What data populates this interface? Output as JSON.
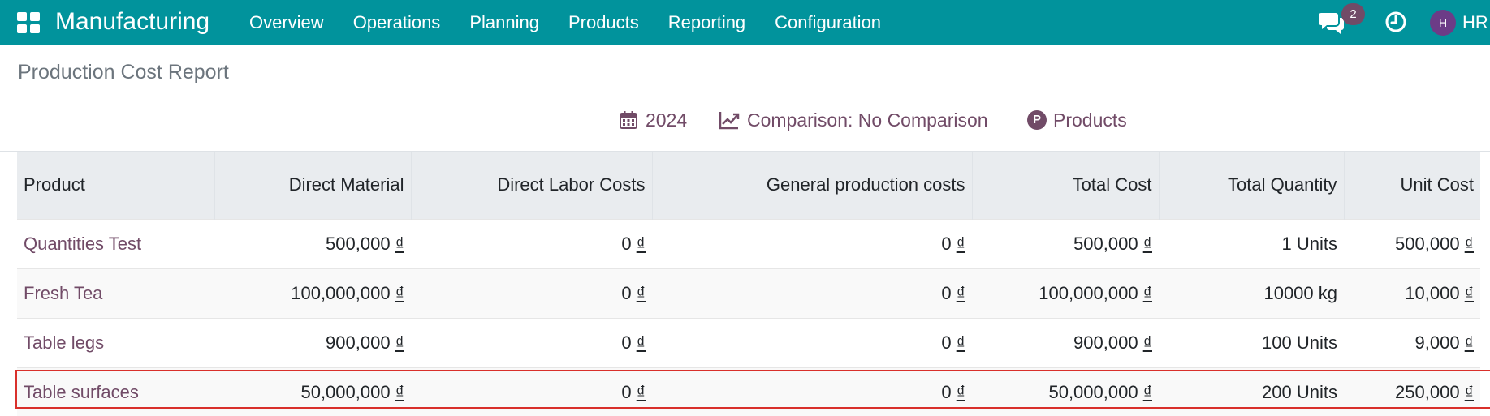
{
  "navbar": {
    "brand": "Manufacturing",
    "menu": [
      "Overview",
      "Operations",
      "Planning",
      "Products",
      "Reporting",
      "Configuration"
    ],
    "chat_badge": "2",
    "avatar_initial": "H",
    "user_name": "HR",
    "color": "#01939c"
  },
  "page": {
    "title": "Production Cost Report"
  },
  "filters": {
    "year": "2024",
    "comparison": "Comparison: No Comparison",
    "products_initial": "P",
    "products": "Products"
  },
  "table": {
    "headers": [
      "Product",
      "Direct Material",
      "Direct Labor Costs",
      "General production costs",
      "Total Cost",
      "Total Quantity",
      "Unit Cost"
    ],
    "currency": "₫",
    "rows": [
      {
        "product": "Quantities Test",
        "direct_material": "500,000",
        "direct_labor": "0",
        "general": "0",
        "total_cost": "500,000",
        "total_quantity": "1 Units",
        "unit_cost": "500,000"
      },
      {
        "product": "Fresh Tea",
        "direct_material": "100,000,000",
        "direct_labor": "0",
        "general": "0",
        "total_cost": "100,000,000",
        "total_quantity": "10000 kg",
        "unit_cost": "10,000"
      },
      {
        "product": "Table legs",
        "direct_material": "900,000",
        "direct_labor": "0",
        "general": "0",
        "total_cost": "900,000",
        "total_quantity": "100 Units",
        "unit_cost": "9,000"
      },
      {
        "product": "Table surfaces",
        "direct_material": "50,000,000",
        "direct_labor": "0",
        "general": "0",
        "total_cost": "50,000,000",
        "total_quantity": "200 Units",
        "unit_cost": "250,000"
      }
    ]
  },
  "colors": {
    "accent": "#714b67",
    "highlight": "#d9302b"
  }
}
